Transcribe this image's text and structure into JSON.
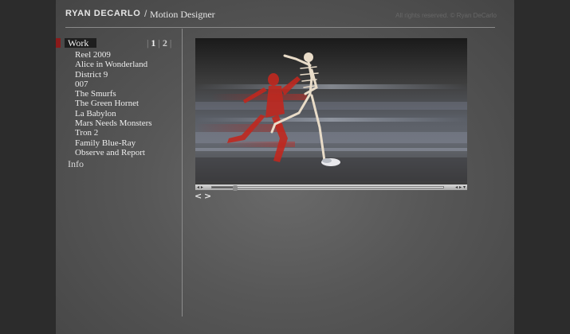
{
  "header": {
    "name": "RYAN DECARLO",
    "separator": "/",
    "role": "Motion Designer",
    "copyright": "All rights reserved. © Ryan DeCarlo"
  },
  "nav": {
    "work_label": "Work",
    "pages": [
      "1",
      "2"
    ],
    "work_items": [
      "Reel 2009",
      "Alice in Wonderland",
      "District 9",
      "007",
      "The Smurfs",
      "The Green Hornet",
      "La Babylon",
      "Mars Needs Monsters",
      "Tron 2",
      "Family Blue-Ray",
      "Observe and Report"
    ],
    "info_label": "Info"
  },
  "player": {
    "controls_left": "◂ ▸",
    "controls_right": "◂ ▸ ▾",
    "progress": 0.09
  },
  "pager_arrows": {
    "prev": "<",
    "next": ">"
  },
  "colors": {
    "accent": "#8b1a1a",
    "background": "#2c2c2c"
  },
  "icons": {
    "prev": "chevron-left-icon",
    "next": "chevron-right-icon",
    "play": "play-icon",
    "volume": "volume-icon"
  }
}
